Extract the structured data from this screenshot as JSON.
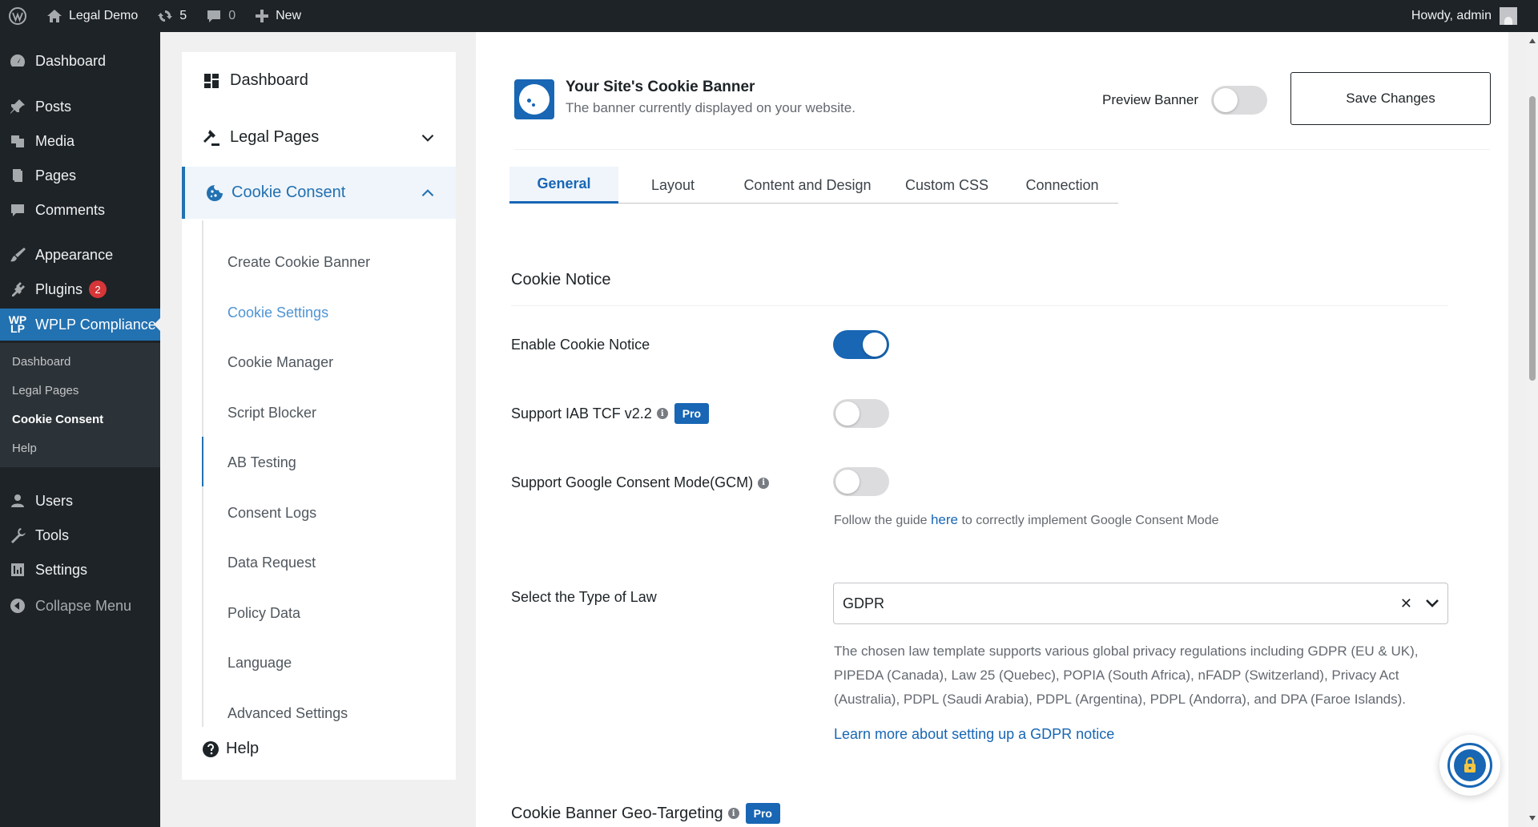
{
  "admin_bar": {
    "site_name": "Legal Demo",
    "updates_count": "5",
    "comments_count": "0",
    "new_label": "New",
    "greeting": "Howdy, admin"
  },
  "admin_menu": {
    "items": [
      {
        "label": "Dashboard",
        "icon": "dashboard-icon"
      },
      {
        "label": "Posts",
        "icon": "pin-icon"
      },
      {
        "label": "Media",
        "icon": "media-icon"
      },
      {
        "label": "Pages",
        "icon": "pages-icon"
      },
      {
        "label": "Comments",
        "icon": "comment-icon"
      },
      {
        "label": "Appearance",
        "icon": "brush-icon"
      },
      {
        "label": "Plugins",
        "icon": "plug-icon",
        "badge": "2"
      },
      {
        "label": "WPLP Compliance",
        "icon": "wplp-logo-icon"
      },
      {
        "label": "Users",
        "icon": "user-icon"
      },
      {
        "label": "Tools",
        "icon": "wrench-icon"
      },
      {
        "label": "Settings",
        "icon": "sliders-icon"
      },
      {
        "label": "Collapse Menu",
        "icon": "collapse-icon"
      }
    ],
    "logo_text": "WP\nLP",
    "submenu": [
      "Dashboard",
      "Legal Pages",
      "Cookie Consent",
      "Help"
    ]
  },
  "plugin_nav": {
    "dashboard": "Dashboard",
    "legal_pages": "Legal Pages",
    "cookie_consent": "Cookie Consent",
    "sub_items": [
      "Create Cookie Banner",
      "Cookie Settings",
      "Cookie Manager",
      "Script Blocker",
      "AB Testing",
      "Consent Logs",
      "Data Request",
      "Policy Data",
      "Language",
      "Advanced Settings"
    ],
    "help": "Help"
  },
  "header": {
    "title": "Your Site's Cookie Banner",
    "subtitle": "The banner currently displayed on your website.",
    "preview_label": "Preview Banner",
    "preview_enabled": false,
    "save_label": "Save Changes"
  },
  "tabs": [
    "General",
    "Layout",
    "Content and Design",
    "Custom CSS",
    "Connection"
  ],
  "cookie_notice": {
    "section_title": "Cookie Notice",
    "enable_label": "Enable Cookie Notice",
    "enable_value": true,
    "iab_label": "Support IAB TCF v2.2",
    "iab_value": false,
    "gcm_label": "Support Google Consent Mode(GCM)",
    "gcm_value": false,
    "gcm_help_prefix": "Follow the guide ",
    "gcm_help_link": "here",
    "gcm_help_suffix": " to correctly implement Google Consent Mode",
    "pro_label": "Pro",
    "info_glyph": "i"
  },
  "law": {
    "label": "Select the Type of Law",
    "selected": "GDPR",
    "clear_glyph": "✕",
    "description": "The chosen law template supports various global privacy regulations including GDPR (EU & UK), PIPEDA (Canada), Law 25 (Quebec), POPIA (South Africa), nFADP (Switzerland), Privacy Act (Australia), PDPL (Saudi Arabia), PDPL (Argentina), PDPL (Andorra), and DPA (Faroe Islands).",
    "learn_more": "Learn more about setting up a GDPR notice"
  },
  "geo": {
    "section_title": "Cookie Banner Geo-Targeting",
    "pro_label": "Pro"
  },
  "colors": {
    "accent": "#1866b4",
    "admin_bg": "#1d2327",
    "wp_blue": "#2271b1",
    "badge_red": "#d63638"
  }
}
